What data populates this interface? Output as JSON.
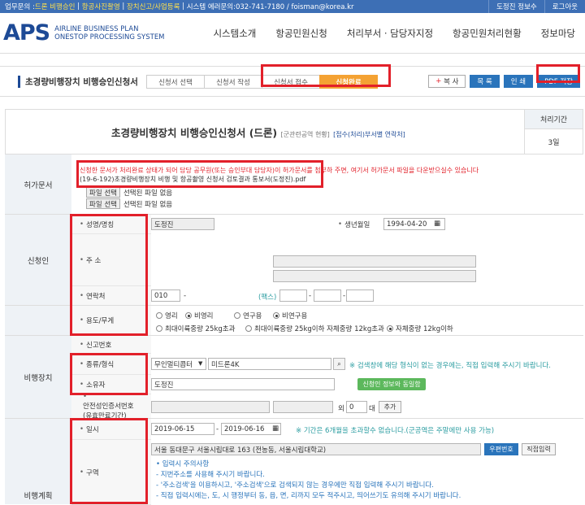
{
  "topbar": {
    "contact_label": "업무문의 : ",
    "drone_label": "드론 비행승인",
    "photo_label": "항공사진촬영",
    "device_label": "장치신고/사업등록",
    "system_label": "시스템 에러문의:032-741-7180 / foisman@korea.kr",
    "user": "도정진 정보수",
    "logout": "로그아웃"
  },
  "logo": {
    "big": "APS",
    "line1": "AIRLINE BUSINESS PLAN",
    "line2": "ONESTOP PROCESSING SYSTEM"
  },
  "nav": [
    "시스템소개",
    "항공민원신청",
    "처리부서 · 담당자지정",
    "항공민원처리현황",
    "정보마당"
  ],
  "page": {
    "title": "초경량비행장치 비행승인신청서",
    "steps": [
      {
        "label": "신청서 선택"
      },
      {
        "label": "신청서 작성"
      },
      {
        "label": "신청서 접수"
      },
      {
        "label": "신청완료"
      }
    ],
    "buttons": {
      "copy_mark": "+",
      "copy": "복   사",
      "list": "목   록",
      "print": "인   쇄",
      "pdf": "PDF 저장"
    }
  },
  "form": {
    "title": "초경량비행장치 비행승인신청서 (드론)",
    "subtitle": "[군관련공역 현황]",
    "link": "[접수(처리)부서별 연락처]",
    "period_label": "처리기간",
    "period_value": "3일"
  },
  "permit": {
    "label": "허가문서",
    "notice": "신청한 문서가 처리완료 상태가 되어 담당 공무원(또는 승인부대 담당자)이 허가문서를 첨부하 주면, 여기서 허가문서 파일을 다운받으실수 있습니다",
    "file": "(19-6-192)초경량비행장치 비행 및 항공촬영 신청서 검토결과 통보서(도정진).pdf",
    "select_btn": "파일 선택",
    "no_file": "선택된 파일 없음"
  },
  "applicant": {
    "label": "신청인",
    "name_label": "성명/명칭",
    "name": "도정진",
    "birth_label": "생년월일",
    "birth": "1994-04-20",
    "address_label": "주 소",
    "phone_label": "연락처",
    "phone1": "010",
    "dash": "-",
    "fax_label": "(팩스)"
  },
  "usage": {
    "label": "용도/무게",
    "opts": [
      "영리",
      "비영리",
      "연구용",
      "비연구용",
      "최대이륙중량 25kg초과",
      "최대이륙중량 25kg이하 자체중량 12kg초과",
      "자체중량 12kg이하"
    ]
  },
  "device": {
    "label": "비행장치",
    "reg_label": "신고번호",
    "type_label": "종류/형식",
    "type": "무인멀티콥터",
    "model": "미드론4K",
    "type_note": "※ 검색창에 해당 형식이 없는 경우에는, 직접 입력해 주시기 바랍니다.",
    "owner_label": "소유자",
    "owner": "도정진",
    "sync_btn": "신청인 정보와 동일함",
    "cert_label1": "안전성인증서번호",
    "cert_label2": "(유효만료기간)",
    "cert_other": "외",
    "cert_count": "0",
    "cert_unit": "대",
    "add_btn": "추가"
  },
  "plan": {
    "label": "비행계획",
    "date_label": "일시",
    "date_from": "2019-06-15",
    "date_to": "2019-06-16",
    "date_note": "※ 기간은 6개월을 초과할수 없습니다.(군공역은 주말에만 사용 가능)",
    "area_label": "구역",
    "area": "서울 동대문구 서울시립대로 163 (전농동, 서울시립대학교)",
    "zip_btn": "우편번호",
    "direct_btn": "직접입력",
    "notes": [
      "• 입력시 주의사항",
      "- 지번주소를 사용해 주시기 바랍니다.",
      "- '주소검색'을 이용하시고, '주소검색'으로 검색되지 않는 경우에만 직접 입력해 주시기 바랍니다.",
      "- 직접 입력시에는, 도, 시 행정부터 동, 읍, 면, 리까지 모두 적주시고, 띄어쓰기도 유의해 주시기 바랍니다."
    ]
  },
  "colors": {
    "accent": "#1d4a96",
    "highlight": "#e2202a",
    "step_done": "#f4a233"
  }
}
